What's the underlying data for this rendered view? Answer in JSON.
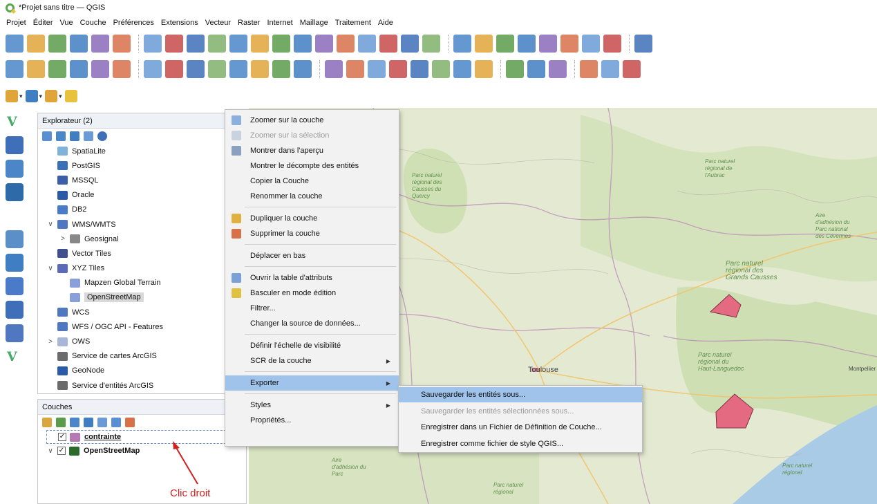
{
  "window": {
    "title": "*Projet sans titre — QGIS"
  },
  "menubar": [
    "Projet",
    "Éditer",
    "Vue",
    "Couche",
    "Préférences",
    "Extensions",
    "Vecteur",
    "Raster",
    "Internet",
    "Maillage",
    "Traitement",
    "Aide"
  ],
  "toolbar1_icons": [
    "new-project-icon",
    "open-project-icon",
    "save-project-icon",
    "save-as-icon",
    "print-layout-icon",
    "layout-manager-icon",
    "pan-icon",
    "pan-to-selection-icon",
    "zoom-in-icon",
    "zoom-out-icon",
    "zoom-full-icon",
    "zoom-to-selection-icon",
    "zoom-to-layer-icon",
    "zoom-native-icon",
    "zoom-last-icon",
    "zoom-next-icon",
    "new-bookmark-icon",
    "show-bookmarks-icon",
    "temporal-controller-icon",
    "refresh-icon",
    "identify-icon",
    "attribute-table-icon",
    "field-calculator-icon",
    "processing-toolbox-icon",
    "statistics-icon",
    "measure-icon",
    "map-tips-icon",
    "select-icon",
    "text-annotation-icon"
  ],
  "toolbar2_icons": [
    "data-source-manager-icon",
    "new-geopackage-icon",
    "new-shapefile-icon",
    "digitize-icon",
    "edit-pencil-icon",
    "save-edits-icon",
    "add-feature-icon",
    "vertex-tool-icon",
    "delete-selected-icon",
    "cut-features-icon",
    "copy-features-icon",
    "paste-features-icon",
    "undo-icon",
    "redo-icon",
    "label-icon",
    "label-pin-icon",
    "label-move-icon",
    "label-rotate-icon",
    "label-change-icon",
    "label-show-icon",
    "label-edit-icon",
    "label-style-icon",
    "georeferencer-icon",
    "globe-icon",
    "geoprocessing-icon",
    "python-icon",
    "plugin-icon",
    "help-icon"
  ],
  "toolbar3_icons": [
    "select-features-icon",
    "select-by-value-icon",
    "deselect-icon",
    "select-location-icon"
  ],
  "left_toolbar_icons": [
    {
      "name": "add-vector-layer-icon",
      "label": "V"
    },
    {
      "name": "add-raster-layer-icon",
      "label": ""
    },
    {
      "name": "add-mesh-layer-icon",
      "label": ""
    },
    {
      "name": "add-delimited-text-icon",
      "label": ""
    },
    {
      "name": "add-spatialite-icon",
      "label": ""
    },
    {
      "name": "add-virtual-layer-icon",
      "label": ""
    },
    {
      "name": "add-postgis-icon",
      "label": ""
    },
    {
      "name": "add-wms-icon",
      "label": ""
    },
    {
      "name": "add-wfs-icon",
      "label": ""
    },
    {
      "name": "add-wcs-icon",
      "label": ""
    },
    {
      "name": "new-vector-layer-icon",
      "label": "V"
    }
  ],
  "browser": {
    "title": "Explorateur (2)",
    "items": [
      {
        "label": "SpatiaLite",
        "icon": "spatialite-icon",
        "color": "#7fb3d9",
        "indent": 0,
        "expander": ""
      },
      {
        "label": "PostGIS",
        "icon": "postgis-icon",
        "color": "#3b6fb6",
        "indent": 0,
        "expander": ""
      },
      {
        "label": "MSSQL",
        "icon": "mssql-icon",
        "color": "#3a5fa8",
        "indent": 0,
        "expander": ""
      },
      {
        "label": "Oracle",
        "icon": "oracle-icon",
        "color": "#2b5aa6",
        "indent": 0,
        "expander": ""
      },
      {
        "label": "DB2",
        "icon": "db2-icon",
        "color": "#4a7bc8",
        "indent": 0,
        "expander": ""
      },
      {
        "label": "WMS/WMTS",
        "icon": "wms-globe-icon",
        "color": "#4f78c0",
        "indent": 0,
        "expander": "∨"
      },
      {
        "label": "Geosignal",
        "icon": "wms-connection-icon",
        "color": "#888888",
        "indent": 1,
        "expander": ">"
      },
      {
        "label": "Vector Tiles",
        "icon": "vector-tiles-icon",
        "color": "#3f4f8f",
        "indent": 0,
        "expander": ""
      },
      {
        "label": "XYZ Tiles",
        "icon": "xyz-tiles-icon",
        "color": "#5a6ab8",
        "indent": 0,
        "expander": "∨"
      },
      {
        "label": "Mapzen Global Terrain",
        "icon": "tile-grid-icon",
        "color": "#8aa0d8",
        "indent": 1,
        "expander": ""
      },
      {
        "label": "OpenStreetMap",
        "icon": "tile-grid-icon",
        "color": "#8aa0d8",
        "indent": 1,
        "expander": "",
        "selected": true
      },
      {
        "label": "WCS",
        "icon": "wcs-globe-icon",
        "color": "#4f78c0",
        "indent": 0,
        "expander": ""
      },
      {
        "label": "WFS / OGC API - Features",
        "icon": "wfs-globe-icon",
        "color": "#4f78c0",
        "indent": 0,
        "expander": ""
      },
      {
        "label": "OWS",
        "icon": "ows-globe-icon",
        "color": "#a9b6d8",
        "indent": 0,
        "expander": ">"
      },
      {
        "label": "Service de cartes ArcGIS",
        "icon": "arcgis-map-icon",
        "color": "#6b6b6b",
        "indent": 0,
        "expander": ""
      },
      {
        "label": "GeoNode",
        "icon": "geonode-icon",
        "color": "#2b5aa6",
        "indent": 0,
        "expander": ""
      },
      {
        "label": "Service d'entités ArcGIS",
        "icon": "arcgis-feature-icon",
        "color": "#6b6b6b",
        "indent": 0,
        "expander": ""
      }
    ]
  },
  "layers": {
    "title": "Couches",
    "items": [
      {
        "label": "contrainte",
        "icon": "polygon-layer-icon",
        "color": "#b47ab3",
        "checked": true,
        "expander": "",
        "selected": true
      },
      {
        "label": "OpenStreetMap",
        "icon": "xyz-layer-icon",
        "color": "#2b6b2b",
        "checked": true,
        "expander": "∨"
      }
    ]
  },
  "context_menu": {
    "items": [
      {
        "label": "Zoomer sur la couche",
        "icon": "zoom-to-layer-icon",
        "disabled": false
      },
      {
        "label": "Zoomer sur la sélection",
        "icon": "zoom-to-selection-icon",
        "disabled": true
      },
      {
        "label": "Montrer dans l'aperçu",
        "icon": "overview-icon",
        "disabled": false
      },
      {
        "label": "Montrer le décompte des entités",
        "icon": "",
        "disabled": false
      },
      {
        "label": "Copier la Couche",
        "icon": "",
        "disabled": false
      },
      {
        "label": "Renommer la couche",
        "icon": "",
        "disabled": false
      },
      {
        "separator": true
      },
      {
        "label": "Dupliquer la couche",
        "icon": "duplicate-layer-icon",
        "disabled": false
      },
      {
        "label": "Supprimer la couche",
        "icon": "remove-layer-icon",
        "disabled": false
      },
      {
        "separator": true
      },
      {
        "label": "Déplacer en bas",
        "icon": "",
        "disabled": false
      },
      {
        "separator": true
      },
      {
        "label": "Ouvrir la table d'attributs",
        "icon": "attribute-table-icon",
        "disabled": false
      },
      {
        "label": "Basculer en mode édition",
        "icon": "edit-pencil-icon",
        "disabled": false
      },
      {
        "label": "Filtrer...",
        "icon": "",
        "disabled": false
      },
      {
        "label": "Changer la source de données...",
        "icon": "",
        "disabled": false
      },
      {
        "separator": true
      },
      {
        "label": "Définir l'échelle de visibilité",
        "icon": "",
        "disabled": false
      },
      {
        "label": "SCR de la couche",
        "icon": "",
        "disabled": false,
        "submenu": true
      },
      {
        "separator": true
      },
      {
        "label": "Exporter",
        "icon": "",
        "disabled": false,
        "submenu": true,
        "highlighted": true
      },
      {
        "separator": true
      },
      {
        "label": "Styles",
        "icon": "",
        "disabled": false,
        "submenu": true
      },
      {
        "label": "Propriétés...",
        "icon": "",
        "disabled": false
      }
    ]
  },
  "export_submenu": {
    "items": [
      {
        "label": "Sauvegarder les entités sous...",
        "disabled": false,
        "highlighted": true
      },
      {
        "label": "Sauvegarder les entités sélectionnées sous...",
        "disabled": true
      },
      {
        "label": "Enregistrer dans un Fichier de Définition de Couche...",
        "disabled": false
      },
      {
        "label": "Enregistrer comme fichier de style QGIS...",
        "disabled": false
      }
    ]
  },
  "map": {
    "labels": [
      {
        "text": "Parc naturel régional de l'Aubrac"
      },
      {
        "text": "Parc naturel régional des Causses du Quercy"
      },
      {
        "text": "Aire d'adhésion du Parc national des Cévennes"
      },
      {
        "text": "Parc naturel régional des Grands Causses"
      },
      {
        "text": "Parc naturel régional du Haut-Languedoc"
      },
      {
        "text": "Toulouse"
      },
      {
        "text": "Montpellier"
      },
      {
        "text": "Aire d'adhésion du Parc"
      },
      {
        "text": "Parc naturel régional"
      },
      {
        "text": "Parc naturel régional"
      }
    ],
    "polygon_color": "#e46a82",
    "sea_color": "#a9cbe6"
  },
  "annotation": {
    "text": "Clic droit",
    "color": "#d0201e"
  }
}
